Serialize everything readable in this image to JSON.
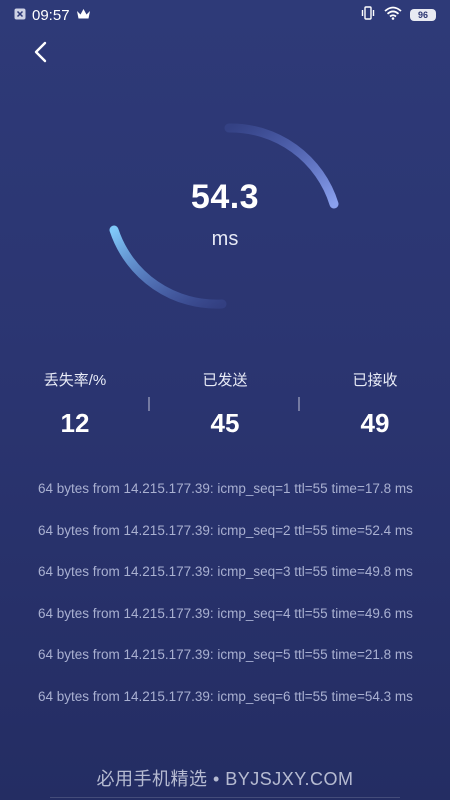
{
  "status_bar": {
    "time": "09:57",
    "battery": "96"
  },
  "gauge": {
    "value": "54.3",
    "unit": "ms",
    "colors": {
      "arc_start": "#7fc8f8",
      "arc_end": "#8aa0ee"
    }
  },
  "stats": [
    {
      "label": "丢失率/%",
      "value": "12"
    },
    {
      "label": "已发送",
      "value": "45"
    },
    {
      "label": "已接收",
      "value": "49"
    }
  ],
  "log": [
    "64 bytes from 14.215.177.39: icmp_seq=1 ttl=55 time=17.8 ms",
    "64 bytes from 14.215.177.39: icmp_seq=2 ttl=55 time=52.4 ms",
    "64 bytes from 14.215.177.39: icmp_seq=3 ttl=55 time=49.8 ms",
    "64 bytes from 14.215.177.39: icmp_seq=4 ttl=55 time=49.6 ms",
    "64 bytes from 14.215.177.39: icmp_seq=5 ttl=55 time=21.8 ms",
    "64 bytes from 14.215.177.39: icmp_seq=6 ttl=55 time=54.3 ms"
  ],
  "watermark": "必用手机精选 • BYJSJXY.COM",
  "icons": {
    "back": "chevron-left-icon",
    "notification": "close-box-icon",
    "crown": "crown-icon",
    "vibrate": "vibrate-icon",
    "wifi": "wifi-icon"
  }
}
